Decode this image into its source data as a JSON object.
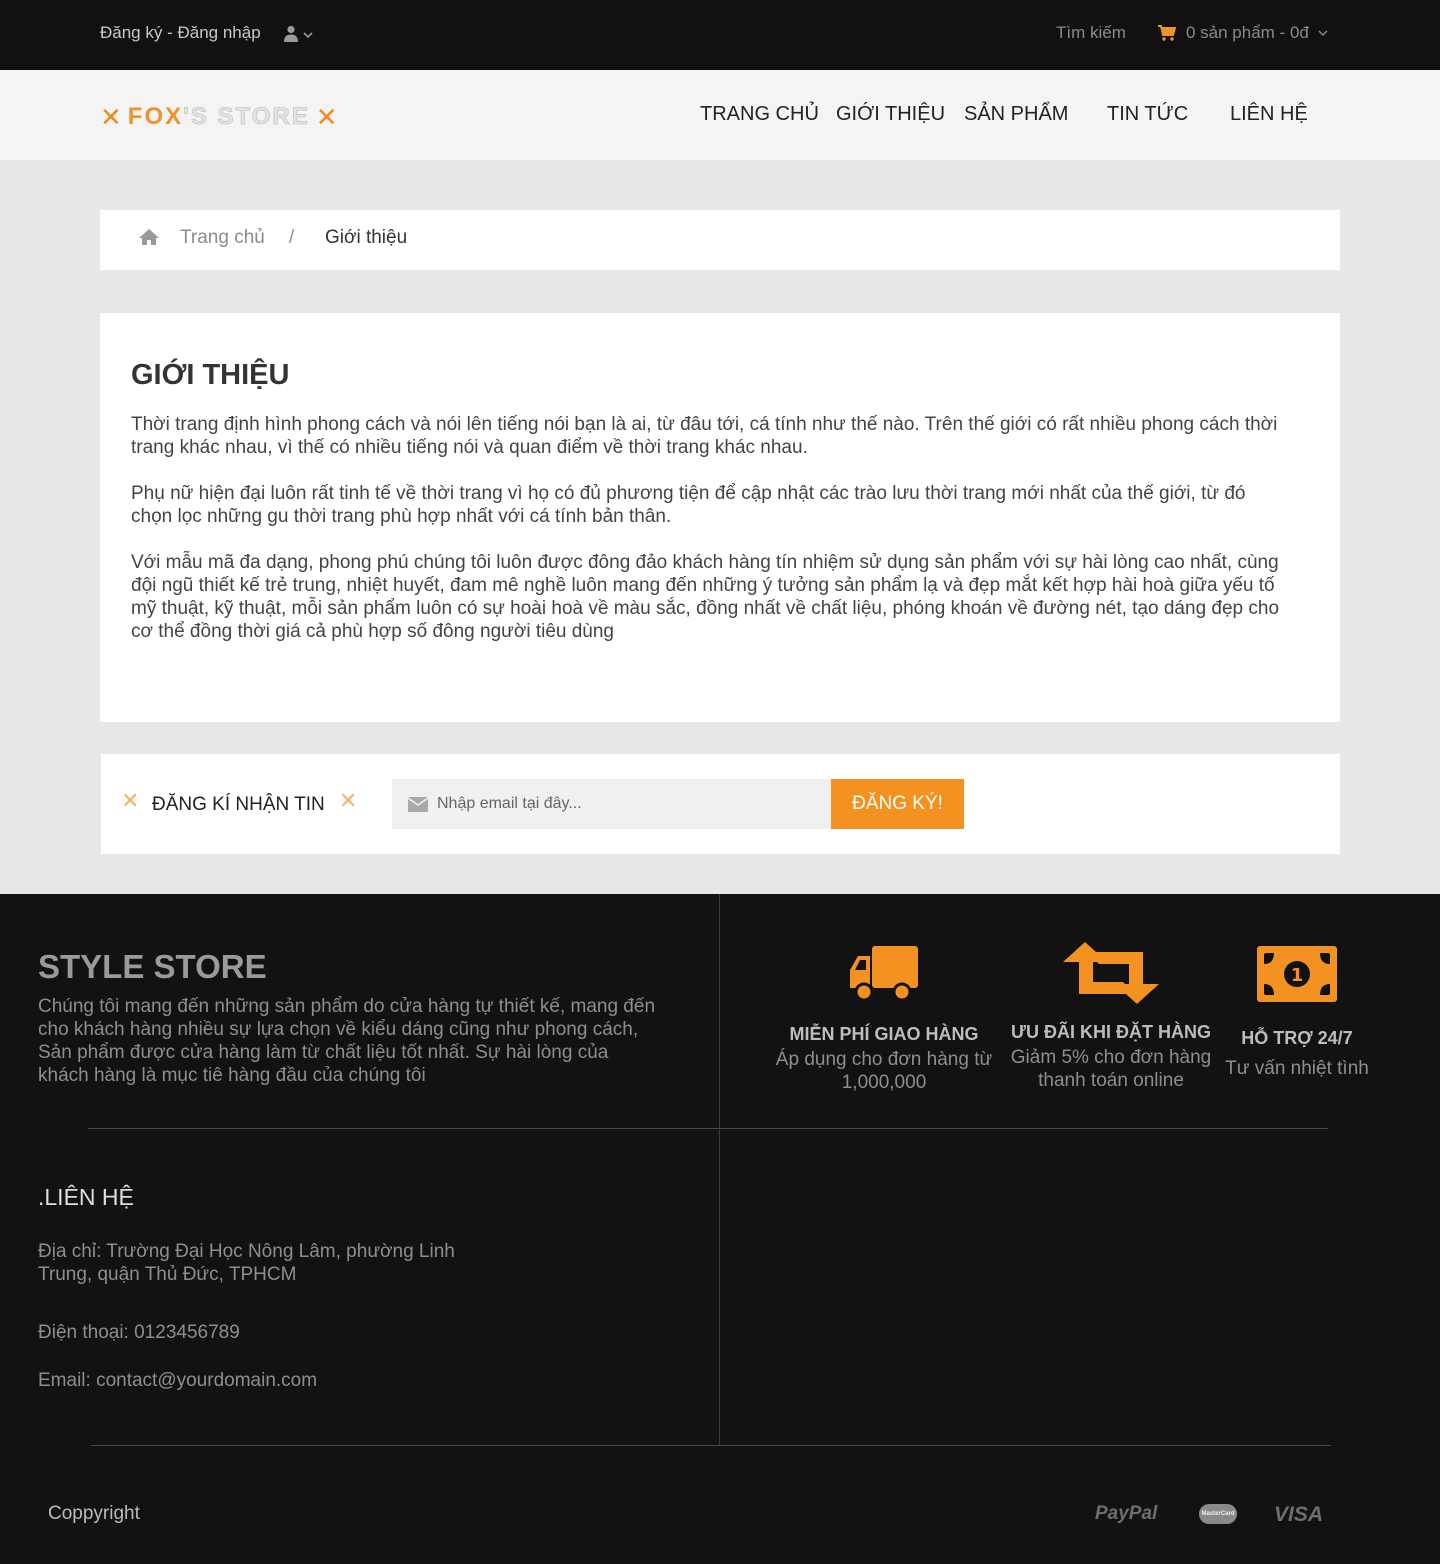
{
  "topbar": {
    "login_label": "Đăng ký - Đăng nhập",
    "search_label": "Tìm kiếm",
    "cart_label": "0 sản phẩm - 0đ"
  },
  "logo": {
    "brand_bold": "FOX",
    "brand_rest": "'S STORE"
  },
  "nav": [
    "TRANG CHỦ",
    "GIỚI THIỆU",
    "SẢN PHẨM",
    "TIN TỨC",
    "LIÊN HỆ"
  ],
  "breadcrumb": {
    "home": "Trang chủ",
    "separator": "/",
    "current": "Giới thiệu"
  },
  "content": {
    "title": "GIỚI THIỆU",
    "paragraphs": [
      "Thời trang định hình phong cách và nói lên tiếng nói bạn là ai, từ đâu tới, cá tính như thế nào. Trên thế giới có rất nhiều phong cách thời trang khác nhau, vì thế có nhiều tiếng nói và quan điểm về thời trang khác nhau.",
      "Phụ nữ hiện đại luôn rất tinh tế về thời trang vì họ có đủ phương tiện để cập nhật các trào lưu thời trang mới nhất của thế giới, từ đó chọn lọc những gu thời trang phù hợp nhất với cá tính bản thân.",
      "Với mẫu mã đa dạng, phong phú  chúng tôi luôn được đông đảo khách hàng tín nhiệm sử dụng sản phẩm với sự hài lòng cao nhất, cùng đội ngũ thiết kế trẻ trung, nhiệt huyết, đam mê nghề luôn mang đến những ý tưởng sản phẩm lạ và đẹp mắt kết hợp hài hoà giữa yếu tố mỹ thuật, kỹ thuật, mỗi sản phẩm luôn có sự hoài hoà về màu sắc, đồng nhất về chất liệu, phóng khoán về đường nét, tạo dáng đẹp cho cơ thể đồng thời giá cả phù hợp số đông người tiêu dùng"
    ]
  },
  "newsletter": {
    "title": "ĐĂNG KÍ NHẬN TIN",
    "placeholder": "Nhập email tại đây...",
    "button": "ĐĂNG KÝ!"
  },
  "footer": {
    "store_title": "STYLE STORE",
    "store_desc": "Chúng tôi mang đến những sản phẩm do cửa hàng tự thiết kế, mang đến cho khách hàng nhiều sự lựa chọn về kiểu dáng cũng như phong cách, Sản phẩm được cửa hàng làm từ chất liệu tốt nhất. Sự hài lòng của khách hàng là mục tiê hàng đầu của chúng tôi",
    "features": [
      {
        "icon": "truck-icon",
        "title": "MIỄN PHÍ GIAO HÀNG",
        "desc": "Áp dụng cho đơn hàng từ 1,000,000"
      },
      {
        "icon": "retweet-icon",
        "title": "ƯU ĐÃI KHI ĐẶT HÀNG",
        "desc": "Giảm 5% cho đơn hàng thanh toán online"
      },
      {
        "icon": "money-icon",
        "title": "HỖ TRỢ 24/7",
        "desc": "Tư vấn nhiệt tình"
      }
    ],
    "contact_title": ".LIÊN HỆ",
    "address": "Địa chỉ: Trường Đại Học Nông Lâm, phường Linh Trung, quận Thủ Đức, TPHCM",
    "phone": "Điện thoại: 0123456789",
    "email": "Email: contact@yourdomain.com",
    "copyright": "Coppyright",
    "payments": [
      "PayPal",
      "MasterCard",
      "VISA"
    ]
  },
  "colors": {
    "accent": "#f39121",
    "topbar_bg": "#111111",
    "footer_bg": "#121212",
    "page_bg": "#e7e7e7"
  }
}
